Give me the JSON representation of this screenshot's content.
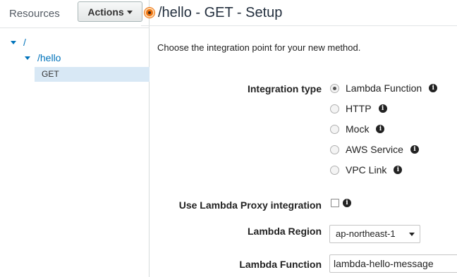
{
  "sidebar": {
    "title": "Resources",
    "actions_label": "Actions",
    "tree": [
      {
        "label": "/"
      },
      {
        "label": "/hello"
      },
      {
        "label": "GET"
      }
    ]
  },
  "main": {
    "title": "/hello - GET - Setup",
    "intro": "Choose the integration point for your new method.",
    "integration_type": {
      "label": "Integration type",
      "options": [
        {
          "label": "Lambda Function",
          "selected": true
        },
        {
          "label": "HTTP",
          "selected": false
        },
        {
          "label": "Mock",
          "selected": false
        },
        {
          "label": "AWS Service",
          "selected": false
        },
        {
          "label": "VPC Link",
          "selected": false
        }
      ]
    },
    "proxy": {
      "label": "Use Lambda Proxy integration",
      "checked": false
    },
    "region": {
      "label": "Lambda Region",
      "value": "ap-northeast-1"
    },
    "function": {
      "label": "Lambda Function",
      "value": "lambda-hello-message"
    }
  },
  "colors": {
    "accent": "#0073bb",
    "status_dot": "#ec7211",
    "selected_row": "#d8e8f5"
  },
  "icons": [
    "caret-down-icon",
    "info-icon",
    "status-dot-icon"
  ]
}
